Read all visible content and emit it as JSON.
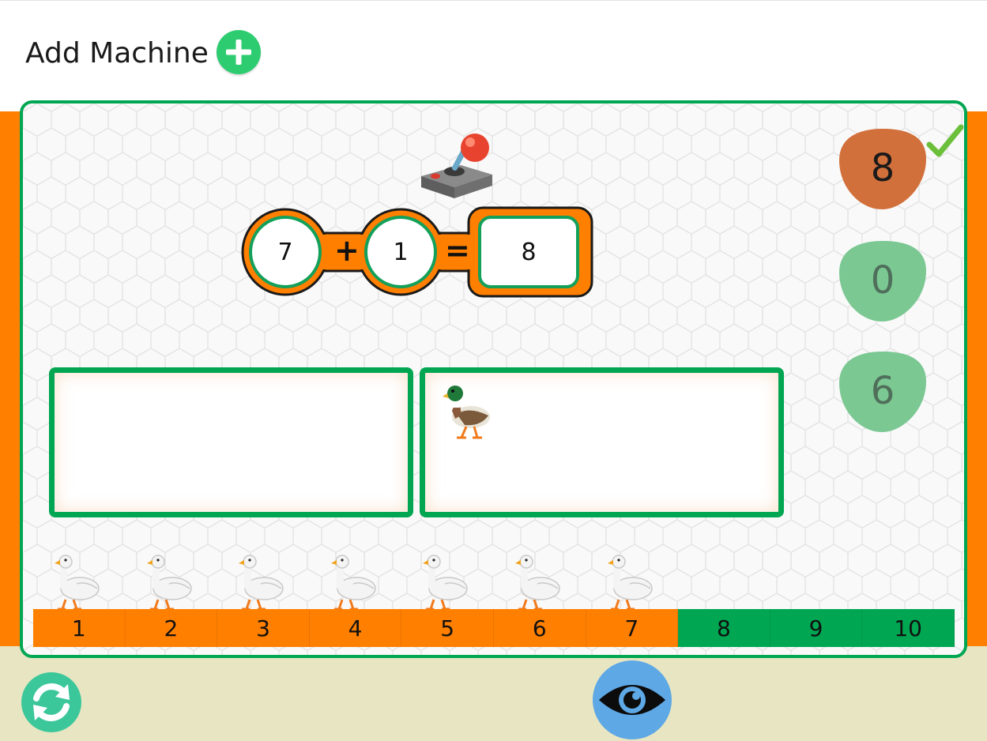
{
  "header": {
    "title": "Add Machine",
    "add_icon": "plus-circle-icon"
  },
  "equation": {
    "operand1": "7",
    "operator": "+",
    "operand2": "1",
    "equals": "=",
    "result": "8"
  },
  "answer_choices": [
    {
      "value": "8",
      "state": "selected",
      "color": "#d2703b"
    },
    {
      "value": "0",
      "state": "idle",
      "color": "#7bc893"
    },
    {
      "value": "6",
      "state": "idle",
      "color": "#7bc893"
    }
  ],
  "number_line": {
    "cells": [
      "1",
      "2",
      "3",
      "4",
      "5",
      "6",
      "7",
      "8",
      "9",
      "10"
    ],
    "highlighted_up_to": 7,
    "highlight_color": "#ff7f00",
    "base_color": "#00a651"
  },
  "geese_count": 7,
  "zone_right_items": [
    "duck-icon"
  ],
  "colors": {
    "accent": "#00a651",
    "band": "#ff7f00",
    "footer": "#e8e6c2",
    "eye": "#5ea8e6",
    "refresh": "#3cc79b"
  },
  "icons": {
    "joystick": "joystick-icon",
    "check": "check-icon",
    "refresh": "refresh-icon",
    "eye": "eye-icon",
    "goose": "goose-icon"
  }
}
